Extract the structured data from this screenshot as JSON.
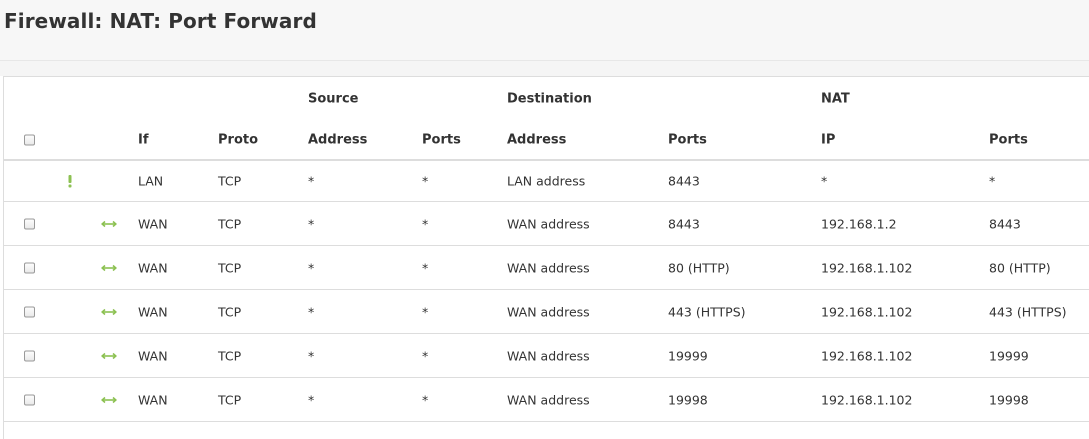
{
  "page": {
    "title": "Firewall: NAT: Port Forward"
  },
  "colors": {
    "accent_green": "#8cc152",
    "border": "#dddddd",
    "header_bg": "#f7f7f7"
  },
  "table": {
    "group_headers": {
      "source": "Source",
      "destination": "Destination",
      "nat": "NAT"
    },
    "columns": {
      "interface": "If",
      "proto": "Proto",
      "source_address": "Address",
      "source_ports": "Ports",
      "destination_address": "Address",
      "destination_ports": "Ports",
      "nat_ip": "IP",
      "nat_ports": "Ports"
    },
    "rows": [
      {
        "icon": "warning-icon",
        "selectable": false,
        "interface": "LAN",
        "proto": "TCP",
        "source_address": "*",
        "source_ports": "*",
        "destination_address": "LAN address",
        "destination_ports": "8443",
        "nat_ip": "*",
        "nat_ports": "*"
      },
      {
        "icon": "bidirectional-arrow-icon",
        "selectable": true,
        "interface": "WAN",
        "proto": "TCP",
        "source_address": "*",
        "source_ports": "*",
        "destination_address": "WAN address",
        "destination_ports": "8443",
        "nat_ip": "192.168.1.2",
        "nat_ports": "8443"
      },
      {
        "icon": "bidirectional-arrow-icon",
        "selectable": true,
        "interface": "WAN",
        "proto": "TCP",
        "source_address": "*",
        "source_ports": "*",
        "destination_address": "WAN address",
        "destination_ports": "80 (HTTP)",
        "nat_ip": "192.168.1.102",
        "nat_ports": "80 (HTTP)"
      },
      {
        "icon": "bidirectional-arrow-icon",
        "selectable": true,
        "interface": "WAN",
        "proto": "TCP",
        "source_address": "*",
        "source_ports": "*",
        "destination_address": "WAN address",
        "destination_ports": "443 (HTTPS)",
        "nat_ip": "192.168.1.102",
        "nat_ports": "443 (HTTPS)"
      },
      {
        "icon": "bidirectional-arrow-icon",
        "selectable": true,
        "interface": "WAN",
        "proto": "TCP",
        "source_address": "*",
        "source_ports": "*",
        "destination_address": "WAN address",
        "destination_ports": "19999",
        "nat_ip": "192.168.1.102",
        "nat_ports": "19999"
      },
      {
        "icon": "bidirectional-arrow-icon",
        "selectable": true,
        "interface": "WAN",
        "proto": "TCP",
        "source_address": "*",
        "source_ports": "*",
        "destination_address": "WAN address",
        "destination_ports": "19998",
        "nat_ip": "192.168.1.102",
        "nat_ports": "19998"
      }
    ]
  }
}
